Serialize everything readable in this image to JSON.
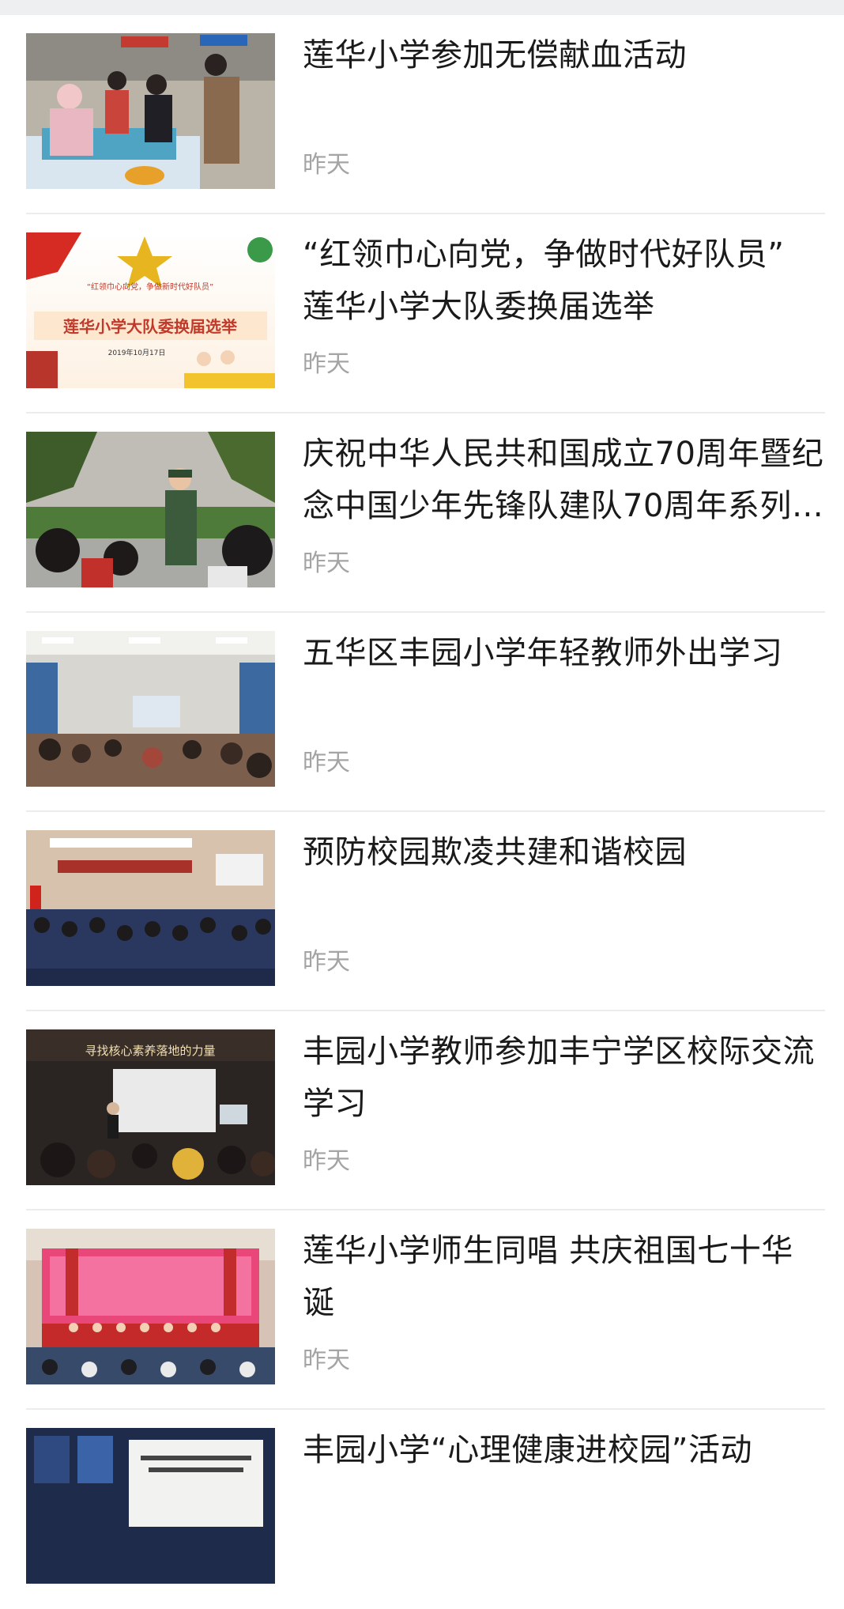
{
  "feed": {
    "items": [
      {
        "title": "莲华小学参加无偿献血活动",
        "date": "昨天",
        "thumb": "blood-donation-photo"
      },
      {
        "title": "“红领巾心向党，争做时代好队员” 莲华小学大队委换届选举",
        "date": "昨天",
        "thumb": "election-banner-photo",
        "thumb_text": {
          "slogan": "“红领巾心向党，争做新时代好队员”",
          "banner": "莲华小学大队委换届选举",
          "date": "2019年10月17日"
        }
      },
      {
        "title": "庆祝中华人民共和国成立70周年暨纪念中国少年先锋队建队70周年系列…",
        "date": "昨天",
        "thumb": "young-pioneers-photo"
      },
      {
        "title": "五华区丰园小学年轻教师外出学习",
        "date": "昨天",
        "thumb": "lecture-hall-photo"
      },
      {
        "title": "预防校园欺凌共建和谐校园",
        "date": "昨天",
        "thumb": "school-assembly-photo"
      },
      {
        "title": "丰园小学教师参加丰宁学区校际交流学习",
        "date": "昨天",
        "thumb": "exchange-meeting-photo",
        "thumb_text": {
          "banner": "寻找核心素养落地的力量"
        }
      },
      {
        "title": "莲华小学师生同唱 共庆祖国七十华诞",
        "date": "昨天",
        "thumb": "chorus-stage-photo"
      },
      {
        "title": "丰园小学“心理健康进校园”活动",
        "date": "",
        "thumb": "presentation-screen-photo"
      }
    ]
  },
  "colors": {
    "title": "#1a1a1a",
    "date": "#a4a4a4",
    "divider": "#ececec",
    "top_strip": "#eeeff1"
  }
}
